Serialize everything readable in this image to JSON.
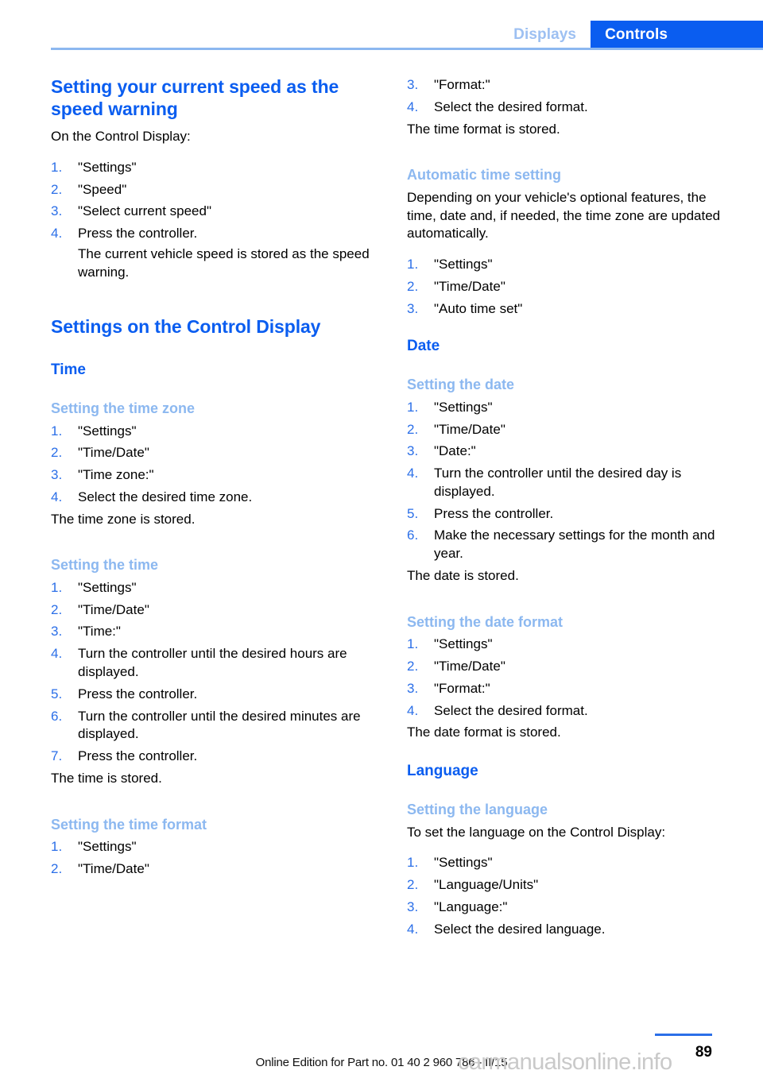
{
  "header": {
    "tab_inactive": "Displays",
    "tab_active": "Controls"
  },
  "colors": {
    "accent_blue": "#0A5DF0",
    "light_blue": "#8CB8F0",
    "number_blue": "#2B6FE8",
    "tab_active_bg": "#0A5DF0",
    "watermark_gray": "#C9C9C9"
  },
  "left_column": {
    "section1": {
      "title": "Setting your current speed as the speed warning",
      "intro": "On the Control Display:",
      "steps": [
        {
          "text": "\"Settings\""
        },
        {
          "text": "\"Speed\""
        },
        {
          "text": "\"Select current speed\""
        },
        {
          "text": "Press the controller.",
          "continuation": "The current vehicle speed is stored as the speed warning."
        }
      ]
    },
    "section2": {
      "title": "Settings on the Control Display",
      "group_time": "Time",
      "time_zone": {
        "subtitle": "Setting the time zone",
        "steps": [
          {
            "text": "\"Settings\""
          },
          {
            "text": "\"Time/Date\""
          },
          {
            "text": "\"Time zone:\""
          },
          {
            "text": "Select the desired time zone."
          }
        ],
        "result": "The time zone is stored."
      },
      "time": {
        "subtitle": "Setting the time",
        "steps": [
          {
            "text": "\"Settings\""
          },
          {
            "text": "\"Time/Date\""
          },
          {
            "text": "\"Time:\""
          },
          {
            "text": "Turn the controller until the desired hours are displayed."
          },
          {
            "text": "Press the controller."
          },
          {
            "text": "Turn the controller until the desired minutes are displayed."
          },
          {
            "text": "Press the controller."
          }
        ],
        "result": "The time is stored."
      },
      "time_format": {
        "subtitle": "Setting the time format",
        "steps": [
          {
            "text": "\"Settings\""
          },
          {
            "text": "\"Time/Date\""
          }
        ]
      }
    }
  },
  "right_column": {
    "time_format_cont": {
      "steps": [
        {
          "number": 3,
          "text": "\"Format:\""
        },
        {
          "number": 4,
          "text": "Select the desired format."
        }
      ],
      "result": "The time format is stored."
    },
    "auto_time": {
      "subtitle": "Automatic time setting",
      "intro": "Depending on your vehicle's optional features, the time, date and, if needed, the time zone are updated automatically.",
      "steps": [
        {
          "text": "\"Settings\""
        },
        {
          "text": "\"Time/Date\""
        },
        {
          "text": "\"Auto time set\""
        }
      ]
    },
    "group_date": "Date",
    "date": {
      "subtitle": "Setting the date",
      "steps": [
        {
          "text": "\"Settings\""
        },
        {
          "text": "\"Time/Date\""
        },
        {
          "text": "\"Date:\""
        },
        {
          "text": "Turn the controller until the desired day is displayed."
        },
        {
          "text": "Press the controller."
        },
        {
          "text": "Make the necessary settings for the month and year."
        }
      ],
      "result": "The date is stored."
    },
    "date_format": {
      "subtitle": "Setting the date format",
      "steps": [
        {
          "text": "\"Settings\""
        },
        {
          "text": "\"Time/Date\""
        },
        {
          "text": "\"Format:\""
        },
        {
          "text": "Select the desired format."
        }
      ],
      "result": "The date format is stored."
    },
    "group_language": "Language",
    "language": {
      "subtitle": "Setting the language",
      "intro": "To set the language on the Control Display:",
      "steps": [
        {
          "text": "\"Settings\""
        },
        {
          "text": "\"Language/Units\""
        },
        {
          "text": "\"Language:\""
        },
        {
          "text": "Select the desired language."
        }
      ]
    }
  },
  "footer": {
    "page_number": "89",
    "edition_note": "Online Edition for Part no. 01 40 2 960 786 - II/15",
    "watermark": "carmanualsonline.info"
  }
}
